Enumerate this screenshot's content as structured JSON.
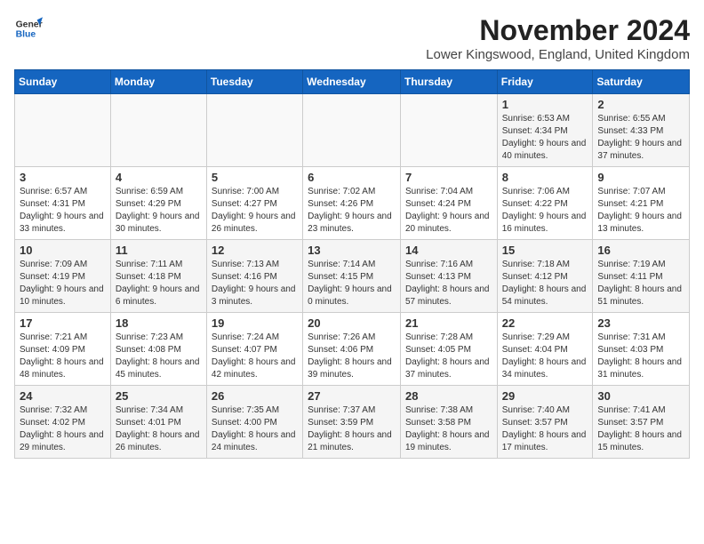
{
  "header": {
    "logo": {
      "general": "General",
      "blue": "Blue"
    },
    "month_year": "November 2024",
    "location": "Lower Kingswood, England, United Kingdom"
  },
  "weekdays": [
    "Sunday",
    "Monday",
    "Tuesday",
    "Wednesday",
    "Thursday",
    "Friday",
    "Saturday"
  ],
  "weeks": [
    [
      {
        "day": "",
        "info": ""
      },
      {
        "day": "",
        "info": ""
      },
      {
        "day": "",
        "info": ""
      },
      {
        "day": "",
        "info": ""
      },
      {
        "day": "",
        "info": ""
      },
      {
        "day": "1",
        "info": "Sunrise: 6:53 AM\nSunset: 4:34 PM\nDaylight: 9 hours and 40 minutes."
      },
      {
        "day": "2",
        "info": "Sunrise: 6:55 AM\nSunset: 4:33 PM\nDaylight: 9 hours and 37 minutes."
      }
    ],
    [
      {
        "day": "3",
        "info": "Sunrise: 6:57 AM\nSunset: 4:31 PM\nDaylight: 9 hours and 33 minutes."
      },
      {
        "day": "4",
        "info": "Sunrise: 6:59 AM\nSunset: 4:29 PM\nDaylight: 9 hours and 30 minutes."
      },
      {
        "day": "5",
        "info": "Sunrise: 7:00 AM\nSunset: 4:27 PM\nDaylight: 9 hours and 26 minutes."
      },
      {
        "day": "6",
        "info": "Sunrise: 7:02 AM\nSunset: 4:26 PM\nDaylight: 9 hours and 23 minutes."
      },
      {
        "day": "7",
        "info": "Sunrise: 7:04 AM\nSunset: 4:24 PM\nDaylight: 9 hours and 20 minutes."
      },
      {
        "day": "8",
        "info": "Sunrise: 7:06 AM\nSunset: 4:22 PM\nDaylight: 9 hours and 16 minutes."
      },
      {
        "day": "9",
        "info": "Sunrise: 7:07 AM\nSunset: 4:21 PM\nDaylight: 9 hours and 13 minutes."
      }
    ],
    [
      {
        "day": "10",
        "info": "Sunrise: 7:09 AM\nSunset: 4:19 PM\nDaylight: 9 hours and 10 minutes."
      },
      {
        "day": "11",
        "info": "Sunrise: 7:11 AM\nSunset: 4:18 PM\nDaylight: 9 hours and 6 minutes."
      },
      {
        "day": "12",
        "info": "Sunrise: 7:13 AM\nSunset: 4:16 PM\nDaylight: 9 hours and 3 minutes."
      },
      {
        "day": "13",
        "info": "Sunrise: 7:14 AM\nSunset: 4:15 PM\nDaylight: 9 hours and 0 minutes."
      },
      {
        "day": "14",
        "info": "Sunrise: 7:16 AM\nSunset: 4:13 PM\nDaylight: 8 hours and 57 minutes."
      },
      {
        "day": "15",
        "info": "Sunrise: 7:18 AM\nSunset: 4:12 PM\nDaylight: 8 hours and 54 minutes."
      },
      {
        "day": "16",
        "info": "Sunrise: 7:19 AM\nSunset: 4:11 PM\nDaylight: 8 hours and 51 minutes."
      }
    ],
    [
      {
        "day": "17",
        "info": "Sunrise: 7:21 AM\nSunset: 4:09 PM\nDaylight: 8 hours and 48 minutes."
      },
      {
        "day": "18",
        "info": "Sunrise: 7:23 AM\nSunset: 4:08 PM\nDaylight: 8 hours and 45 minutes."
      },
      {
        "day": "19",
        "info": "Sunrise: 7:24 AM\nSunset: 4:07 PM\nDaylight: 8 hours and 42 minutes."
      },
      {
        "day": "20",
        "info": "Sunrise: 7:26 AM\nSunset: 4:06 PM\nDaylight: 8 hours and 39 minutes."
      },
      {
        "day": "21",
        "info": "Sunrise: 7:28 AM\nSunset: 4:05 PM\nDaylight: 8 hours and 37 minutes."
      },
      {
        "day": "22",
        "info": "Sunrise: 7:29 AM\nSunset: 4:04 PM\nDaylight: 8 hours and 34 minutes."
      },
      {
        "day": "23",
        "info": "Sunrise: 7:31 AM\nSunset: 4:03 PM\nDaylight: 8 hours and 31 minutes."
      }
    ],
    [
      {
        "day": "24",
        "info": "Sunrise: 7:32 AM\nSunset: 4:02 PM\nDaylight: 8 hours and 29 minutes."
      },
      {
        "day": "25",
        "info": "Sunrise: 7:34 AM\nSunset: 4:01 PM\nDaylight: 8 hours and 26 minutes."
      },
      {
        "day": "26",
        "info": "Sunrise: 7:35 AM\nSunset: 4:00 PM\nDaylight: 8 hours and 24 minutes."
      },
      {
        "day": "27",
        "info": "Sunrise: 7:37 AM\nSunset: 3:59 PM\nDaylight: 8 hours and 21 minutes."
      },
      {
        "day": "28",
        "info": "Sunrise: 7:38 AM\nSunset: 3:58 PM\nDaylight: 8 hours and 19 minutes."
      },
      {
        "day": "29",
        "info": "Sunrise: 7:40 AM\nSunset: 3:57 PM\nDaylight: 8 hours and 17 minutes."
      },
      {
        "day": "30",
        "info": "Sunrise: 7:41 AM\nSunset: 3:57 PM\nDaylight: 8 hours and 15 minutes."
      }
    ]
  ]
}
